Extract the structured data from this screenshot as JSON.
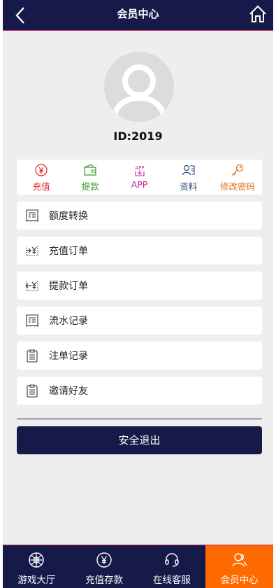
{
  "header": {
    "title": "会员中心"
  },
  "profile": {
    "id_text": "ID:2019"
  },
  "quick_actions": [
    {
      "label": "充值",
      "color": "#e02020",
      "icon": "yuan-circle-icon"
    },
    {
      "label": "提款",
      "color": "#3a9a28",
      "icon": "wallet-icon"
    },
    {
      "label": "APP",
      "color": "#c8209a",
      "icon": "app-icon"
    },
    {
      "label": "资料",
      "color": "#2a4a7a",
      "icon": "profile-card-icon"
    },
    {
      "label": "修改密码",
      "color": "#d8701e",
      "icon": "key-icon"
    }
  ],
  "menu": [
    {
      "label": "额度转换",
      "icon": "receipt-icon"
    },
    {
      "label": "充值订单",
      "icon": "deposit-order-icon"
    },
    {
      "label": "提款订单",
      "icon": "withdraw-order-icon"
    },
    {
      "label": "流水记录",
      "icon": "receipt-icon"
    },
    {
      "label": "注单记录",
      "icon": "clipboard-icon"
    },
    {
      "label": "邀请好友",
      "icon": "clipboard-icon"
    }
  ],
  "logout_label": "安全退出",
  "tabs": [
    {
      "label": "游戏大厅",
      "icon": "lobby-icon"
    },
    {
      "label": "充值存款",
      "icon": "yuan-circle-icon"
    },
    {
      "label": "在线客服",
      "icon": "headset-icon"
    },
    {
      "label": "会员中心",
      "icon": "user-icon",
      "active": true
    }
  ],
  "colors": {
    "navy": "#161a48",
    "accent": "#ff6a00",
    "border_pink": "#c8306a"
  }
}
